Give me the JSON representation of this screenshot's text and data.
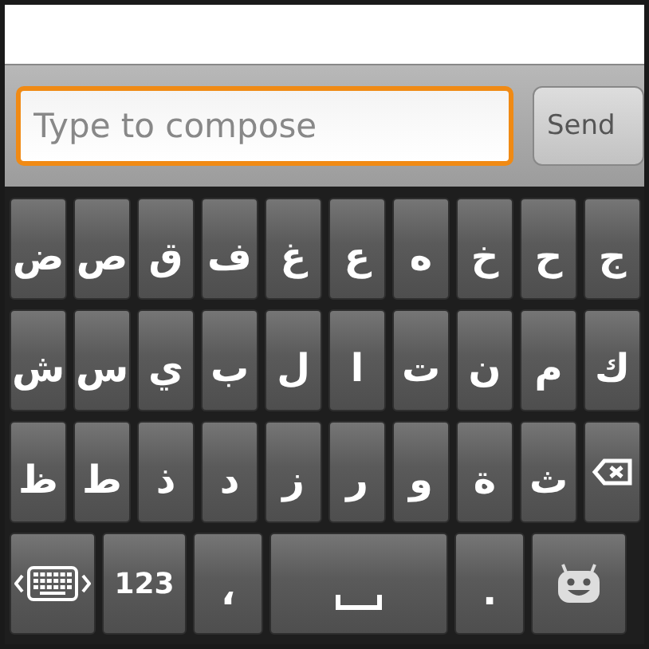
{
  "compose": {
    "placeholder": "Type to compose",
    "focused": true,
    "send": "Send"
  },
  "keyboard": {
    "rows": [
      [
        "ض",
        "ص",
        "ق",
        "ف",
        "غ",
        "ع",
        "ه",
        "خ",
        "ح",
        "ج"
      ],
      [
        "ش",
        "س",
        "ي",
        "ب",
        "ل",
        "ا",
        "ت",
        "ن",
        "م",
        "ك"
      ],
      [
        "ظ",
        "ط",
        "ذ",
        "د",
        "ز",
        "ر",
        "و",
        "ة",
        "ث",
        {
          "kind": "backspace"
        }
      ]
    ],
    "bottom": [
      {
        "kind": "switch"
      },
      {
        "kind": "text",
        "label": "123"
      },
      {
        "kind": "char",
        "label": "،"
      },
      {
        "kind": "space"
      },
      {
        "kind": "char",
        "label": "."
      },
      {
        "kind": "emoji"
      }
    ]
  }
}
